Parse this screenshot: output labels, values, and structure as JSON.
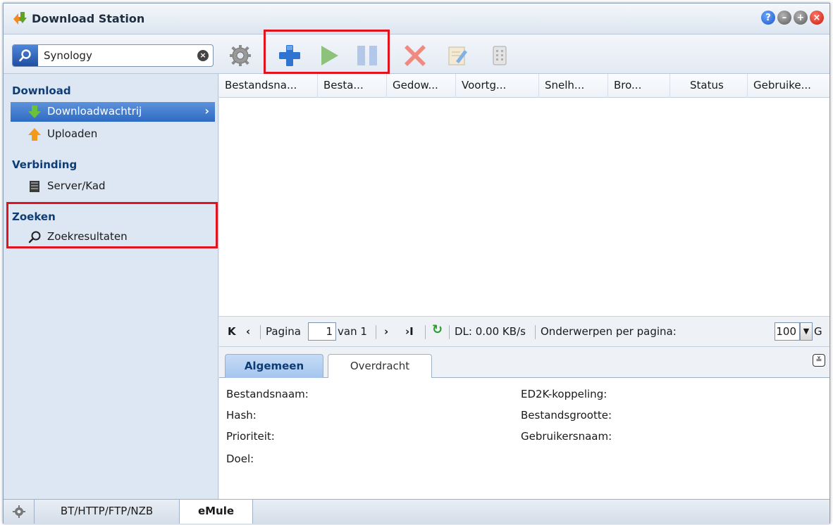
{
  "window": {
    "title": "Download Station"
  },
  "search": {
    "value": "Synology"
  },
  "sidebar": {
    "groups": [
      {
        "label": "Download",
        "items": [
          {
            "label": "Downloadwachtrij"
          },
          {
            "label": "Uploaden"
          }
        ]
      },
      {
        "label": "Verbinding",
        "items": [
          {
            "label": "Server/Kad"
          }
        ]
      },
      {
        "label": "Zoeken",
        "items": [
          {
            "label": "Zoekresultaten"
          }
        ]
      }
    ]
  },
  "grid": {
    "columns": [
      "Bestandsna...",
      "Besta...",
      "Gedow...",
      "Voortg...",
      "Snelh...",
      "Bro...",
      "Status",
      "Gebruike..."
    ]
  },
  "pager": {
    "page_label": "Pagina",
    "page_value": "1",
    "of_label": "van 1",
    "dl_label": "DL: 0.00 KB/s",
    "per_page_label": "Onderwerpen per pagina:",
    "per_page_value": "100",
    "cut_text": "G"
  },
  "details": {
    "tabs": [
      "Algemeen",
      "Overdracht"
    ],
    "fields_left": [
      "Bestandsnaam:",
      "Hash:",
      "Prioriteit:",
      "Doel:"
    ],
    "fields_right": [
      "ED2K-koppeling:",
      "Bestandsgrootte:",
      "Gebruikersnaam:"
    ]
  },
  "bottom_tabs": [
    "BT/HTTP/FTP/NZB",
    "eMule"
  ],
  "colors": {
    "highlight": "#e0141e",
    "accent": "#2f6bc3",
    "group_text": "#0e3d75"
  }
}
